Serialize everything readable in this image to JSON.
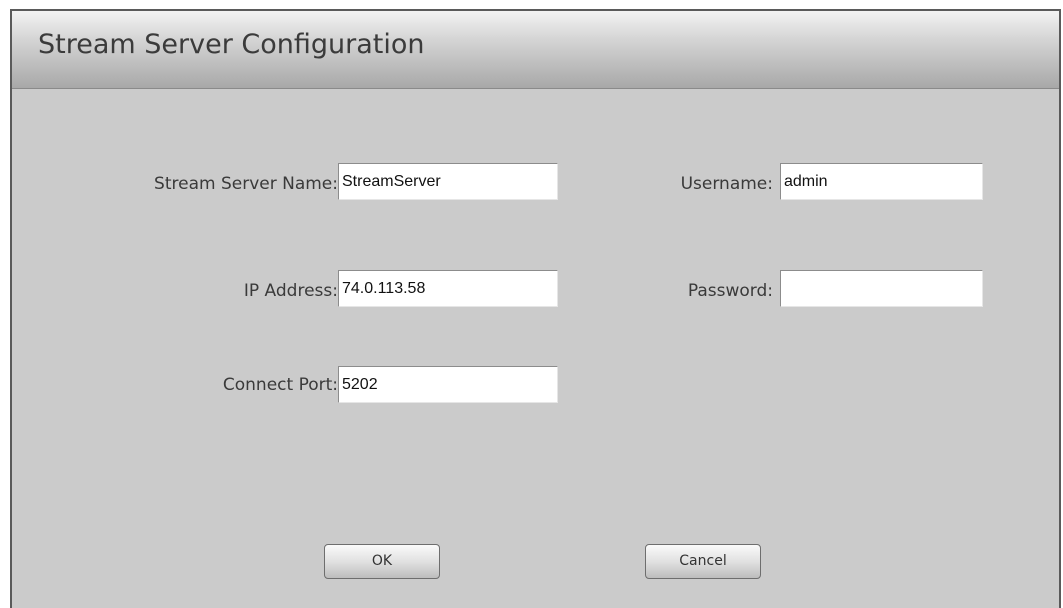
{
  "dialog": {
    "title": "Stream Server Configuration"
  },
  "fields": {
    "server_name": {
      "label": "Stream Server Name:",
      "value": "StreamServer"
    },
    "ip_address": {
      "label": "IP Address:",
      "value": "74.0.113.58"
    },
    "connect_port": {
      "label": "Connect Port:",
      "value": "5202"
    },
    "username": {
      "label": "Username:",
      "value": "admin"
    },
    "password": {
      "label": "Password:",
      "value": ""
    }
  },
  "buttons": {
    "ok": "OK",
    "cancel": "Cancel"
  }
}
